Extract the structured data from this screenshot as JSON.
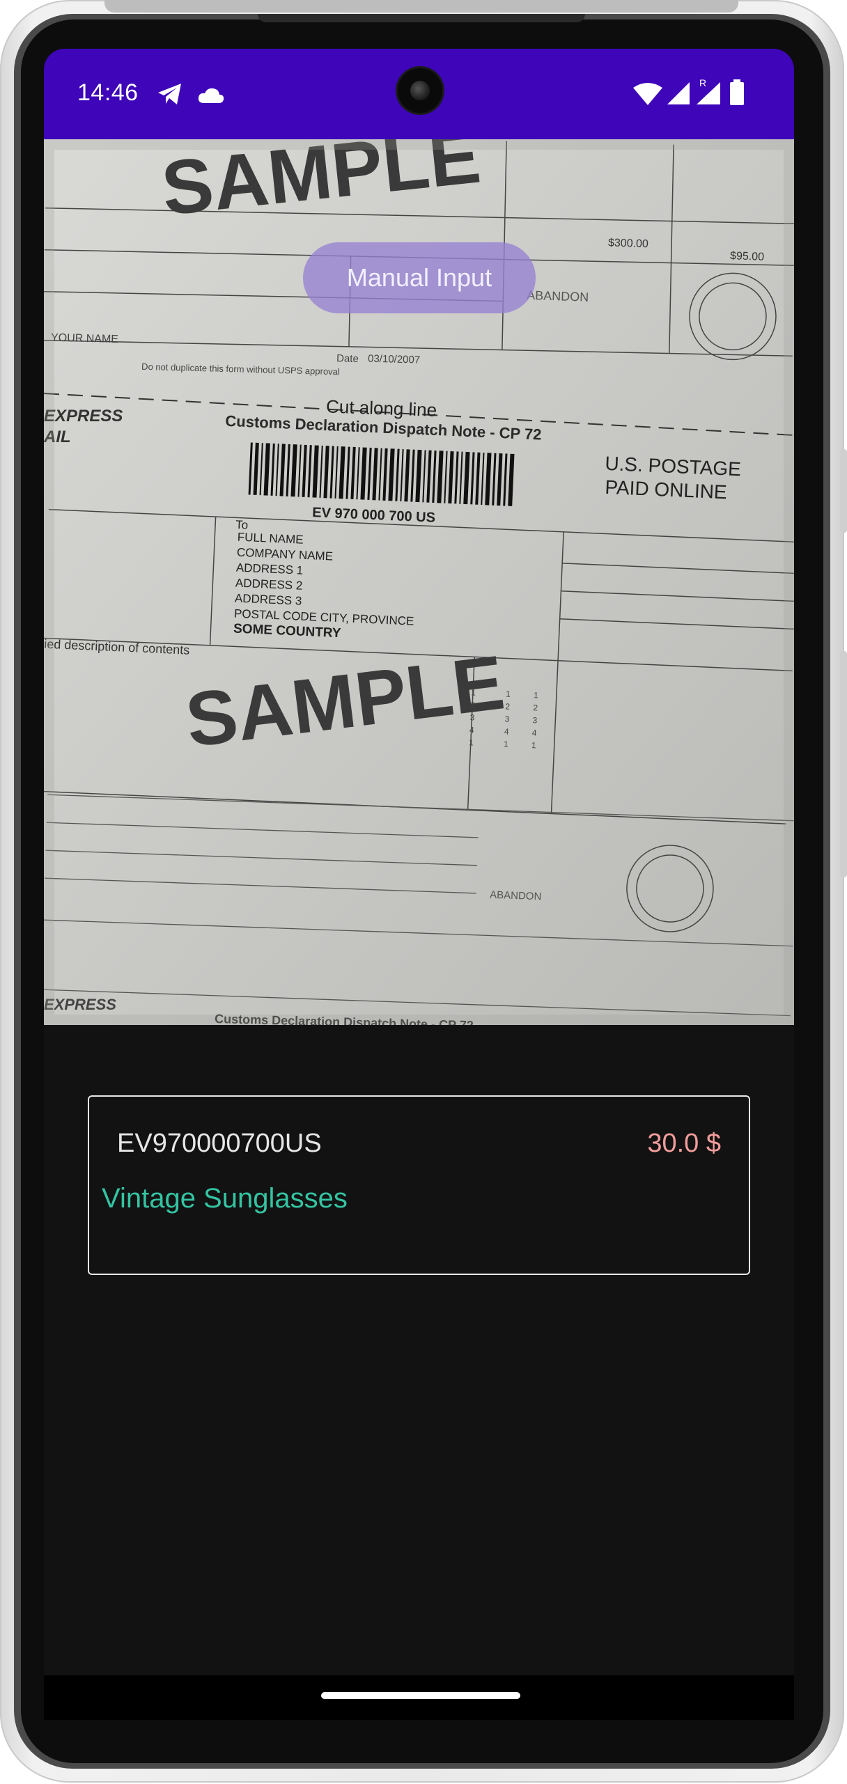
{
  "status_bar": {
    "time": "14:46",
    "left_icons": [
      "telegram-icon",
      "cloud-icon"
    ],
    "right_icons": [
      "wifi-icon",
      "signal-icon",
      "roaming-signal-icon",
      "battery-icon"
    ],
    "roaming_indicator": "R",
    "background_color": "#3e06b8"
  },
  "viewfinder": {
    "description_visible_text": {
      "sample_watermark": "SAMPLE",
      "cut_line": "Cut along line",
      "form_title": "Customs Declaration Dispatch Note - CP 72",
      "barcode_number": "EV 970 000 700 US",
      "postage_line1": "U.S. POSTAGE",
      "postage_line2": "PAID ONLINE",
      "express": "EXPRESS",
      "mail": "AIL",
      "to_label": "To",
      "address": [
        "FULL NAME",
        "COMPANY NAME",
        "ADDRESS 1",
        "ADDRESS 2",
        "ADDRESS 3",
        "POSTAL CODE CITY, PROVINCE",
        "SOME COUNTRY"
      ],
      "contents_label": "ied description of contents",
      "abandon": "ABANDON",
      "total_value": "$300.00",
      "postage_fees": "$95.00",
      "your_name": "YOUR NAME",
      "do_not_duplicate": "Do not duplicate this form without USPS approval",
      "date_label": "Date",
      "date_value": "03/10/2007"
    }
  },
  "manual_input_button": {
    "label": "Manual Input"
  },
  "result": {
    "tracking_number": "EV970000700US",
    "price": "30.0 $",
    "item_name": "Vintage Sunglasses",
    "price_color": "#f29c9c",
    "item_color": "#34c4a2"
  }
}
